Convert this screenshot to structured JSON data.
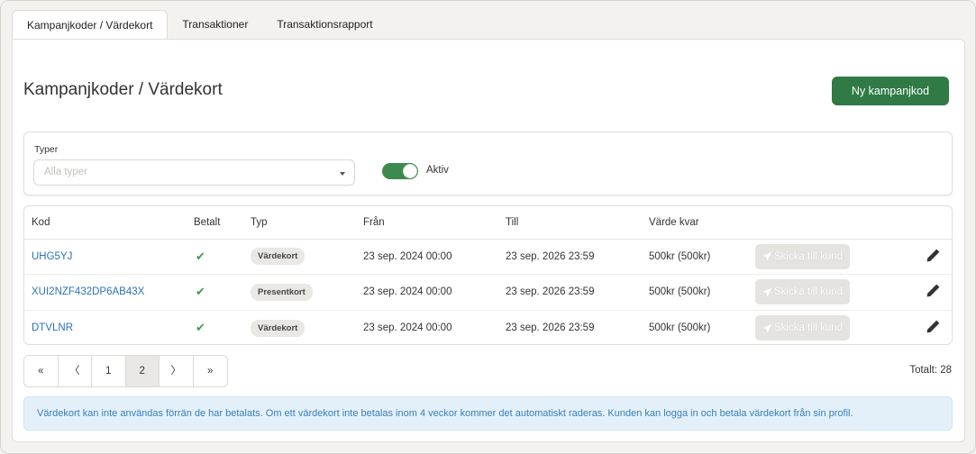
{
  "tabs": [
    {
      "label": "Kampanjkoder / Värdekort",
      "active": true
    },
    {
      "label": "Transaktioner",
      "active": false
    },
    {
      "label": "Transaktionsrapport",
      "active": false
    }
  ],
  "page": {
    "title": "Kampanjkoder / Värdekort",
    "new_button": "Ny kampanjkod"
  },
  "filters": {
    "type_label": "Typer",
    "type_placeholder": "Alla typer",
    "active_label": "Aktiv",
    "active_on": true
  },
  "table": {
    "headers": {
      "kod": "Kod",
      "betalt": "Betalt",
      "typ": "Typ",
      "fran": "Från",
      "till": "Till",
      "varde": "Värde kvar"
    },
    "send_label": "Skicka till kund",
    "rows": [
      {
        "kod": "UHG5YJ",
        "betalt": "✔",
        "typ": "Värdekort",
        "fran": "23 sep. 2024 00:00",
        "till": "23 sep. 2026 23:59",
        "varde": "500kr (500kr)"
      },
      {
        "kod": "XUI2NZF432DP6AB43X",
        "betalt": "✔",
        "typ": "Presentkort",
        "fran": "23 sep. 2024 00:00",
        "till": "23 sep. 2026 23:59",
        "varde": "500kr (500kr)"
      },
      {
        "kod": "DTVLNR",
        "betalt": "✔",
        "typ": "Värdekort",
        "fran": "23 sep. 2024 00:00",
        "till": "23 sep. 2026 23:59",
        "varde": "500kr (500kr)"
      }
    ]
  },
  "pagination": {
    "first": "«",
    "prev": "〈",
    "pages": [
      "1",
      "2"
    ],
    "current": "2",
    "next": "〉",
    "last": "»",
    "total": "Totalt: 28"
  },
  "info": "Värdekort kan inte användas förrän de har betalats. Om ett värdekort inte betalas inom 4 veckor kommer det automatiskt raderas. Kunden kan logga in och betala värdekort från sin profil.",
  "colors": {
    "primary": "#2f7a45",
    "link": "#2b72b8",
    "check": "#3d9a4c",
    "info_bg": "#e3f0fa"
  }
}
